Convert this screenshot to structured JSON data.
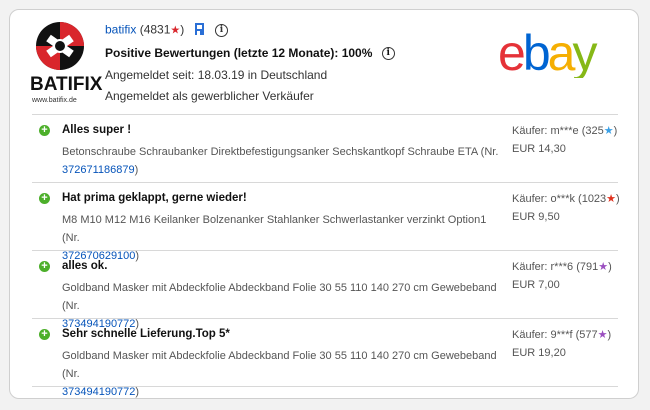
{
  "header": {
    "seller_name": "batifix",
    "rating_count": "(4831",
    "rating_close": ")",
    "positive_label": "Positive Bewertungen (letzte 12 Monate): 100%",
    "member_since": "Angemeldet seit: 18.03.19 in Deutschland",
    "business_label": "Angemeldet als gewerblicher Verkäufer",
    "logo_text": "BATIFIX",
    "logo_url": "www.batifix.de",
    "ebay_letters": [
      "e",
      "b",
      "a",
      "y"
    ],
    "ebay_colors": [
      "#e53238",
      "#0064d2",
      "#f5af02",
      "#86b817"
    ]
  },
  "colors": {
    "link": "#0654ba",
    "positive": "#4caf2a",
    "accent_red": "#d9262c"
  },
  "reviews": [
    {
      "comment": "Alles super !",
      "item_text": "Betonschraube Schraubanker Direktbefestigungsanker Sechskantkopf Schraube ETA (Nr.",
      "item_number": "372671186879",
      "item_close": ")",
      "buyer": "Käufer: m***e (325",
      "buyer_close": ")",
      "star_color": "blue",
      "price": "EUR 14,30"
    },
    {
      "comment": "Hat prima geklappt, gerne wieder!",
      "item_text": "M8 M10 M12 M16 Keilanker Bolzenanker Stahlanker Schwerlastanker verzinkt Option1 (Nr.",
      "item_number": "372670629100",
      "item_close": ")",
      "buyer": "Käufer: o***k (1023",
      "buyer_close": ")",
      "star_color": "red",
      "price": "EUR 9,50"
    },
    {
      "comment": "alles ok.",
      "item_text": "Goldband Masker mit Abdeckfolie Abdeckband Folie 30 55 110 140 270 cm Gewebeband (Nr.",
      "item_number": "373494190772",
      "item_close": ")",
      "buyer": "Käufer: r***6 (791",
      "buyer_close": ")",
      "star_color": "purple",
      "price": "EUR 7,00"
    },
    {
      "comment": "Sehr schnelle Lieferung.Top 5*",
      "item_text": "Goldband Masker mit Abdeckfolie Abdeckband Folie 30 55 110 140 270 cm Gewebeband (Nr.",
      "item_number": "373494190772",
      "item_close": ")",
      "buyer": "Käufer: 9***f (577",
      "buyer_close": ")",
      "star_color": "purple",
      "price": "EUR 19,20"
    }
  ]
}
